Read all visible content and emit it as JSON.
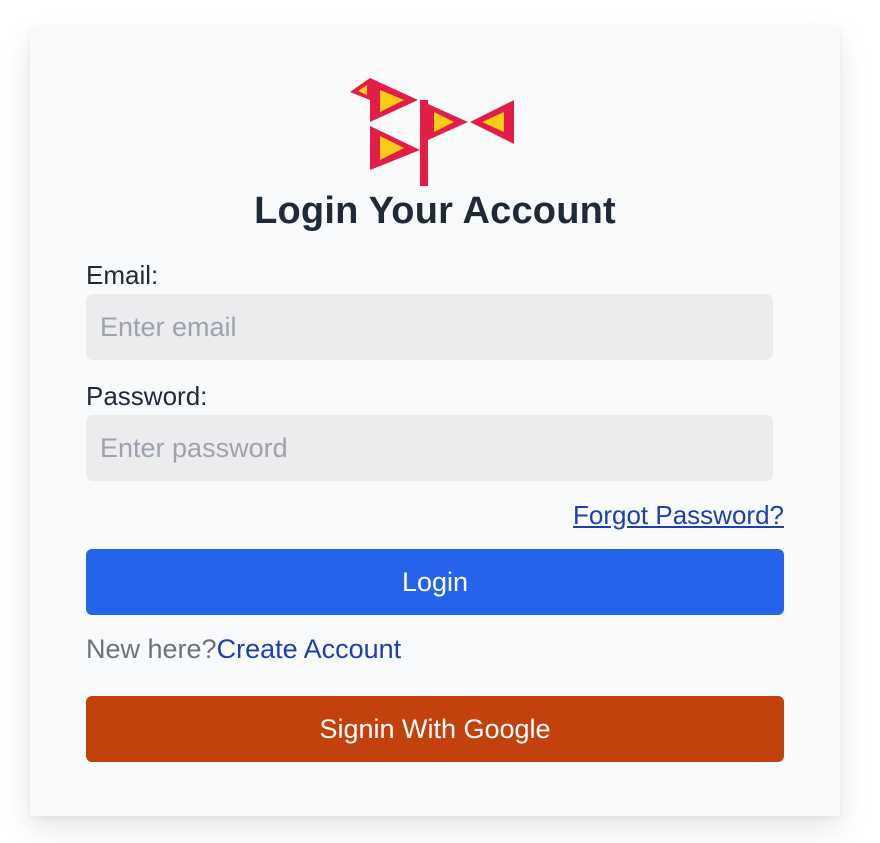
{
  "page_title": "Login Your Account",
  "logo": {
    "name": "flags-logo",
    "colors": {
      "red": "#e11d48",
      "yellow": "#facc15"
    }
  },
  "form": {
    "email_label": "Email:",
    "email_placeholder": "Enter email",
    "password_label": "Password:",
    "password_placeholder": "Enter password",
    "forgot_link": "Forgot Password?",
    "login_button": "Login",
    "new_here_text": "New here?",
    "create_account_link": "Create Account",
    "google_button": "Signin With Google"
  },
  "colors": {
    "primary": "#2563eb",
    "google": "#c2410c",
    "link": "#1e40af",
    "input_bg": "#ececee"
  }
}
